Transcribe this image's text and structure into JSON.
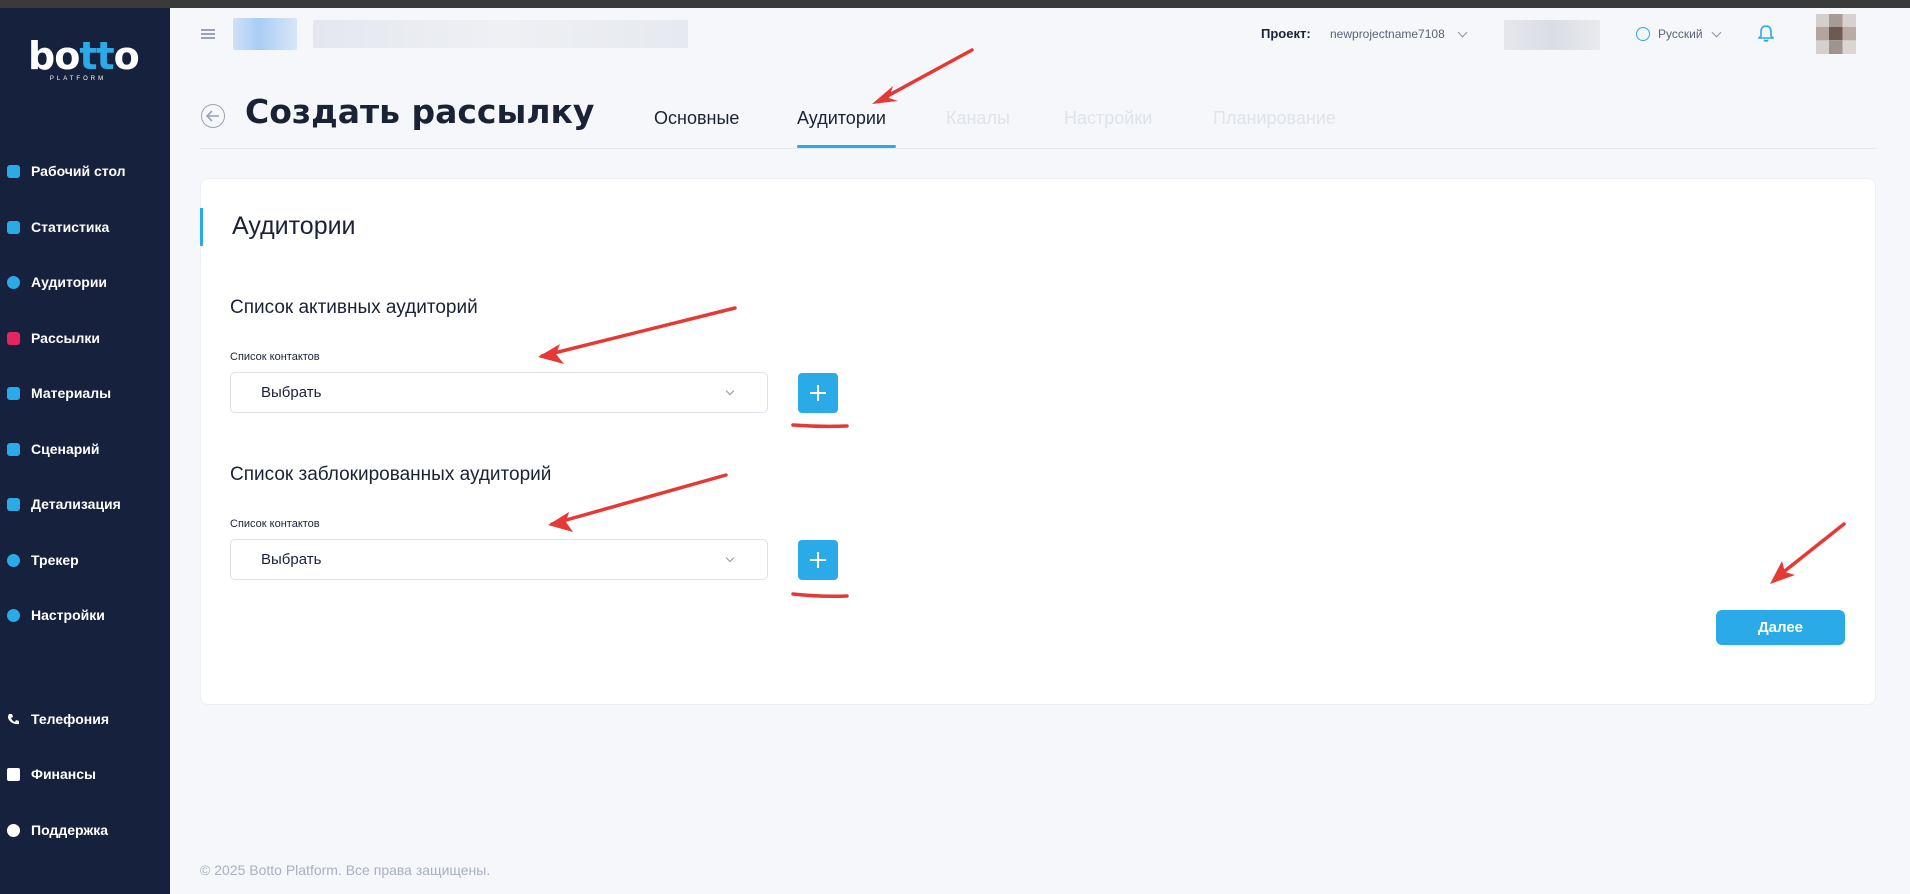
{
  "app": {
    "logo_text": "botto",
    "logo_subtitle": "PLATFORM"
  },
  "sidebar": {
    "items": [
      {
        "label": "Рабочий стол",
        "icon": "dashboard-icon"
      },
      {
        "label": "Статистика",
        "icon": "chart-icon"
      },
      {
        "label": "Аудитории",
        "icon": "users-icon"
      },
      {
        "label": "Рассылки",
        "icon": "mailing-icon"
      },
      {
        "label": "Материалы",
        "icon": "files-icon"
      },
      {
        "label": "Сценарий",
        "icon": "scenario-icon"
      },
      {
        "label": "Детализация",
        "icon": "details-icon"
      },
      {
        "label": "Трекер",
        "icon": "tracker-icon"
      },
      {
        "label": "Настройки",
        "icon": "gear-icon"
      },
      {
        "label": "Телефония",
        "icon": "phone-icon"
      },
      {
        "label": "Финансы",
        "icon": "wallet-icon"
      },
      {
        "label": "Поддержка",
        "icon": "support-icon"
      }
    ]
  },
  "header": {
    "project_label": "Проект:",
    "project_value": "newprojectname7108",
    "language": "Русский"
  },
  "page": {
    "title": "Создать рассылку",
    "tabs": [
      {
        "label": "Основные",
        "state": "enabled"
      },
      {
        "label": "Аудитории",
        "state": "active"
      },
      {
        "label": "Каналы",
        "state": "disabled"
      },
      {
        "label": "Настройки",
        "state": "disabled"
      },
      {
        "label": "Планирование",
        "state": "disabled"
      }
    ]
  },
  "card": {
    "title": "Аудитории",
    "active_section": {
      "title": "Список активных аудиторий",
      "field_label": "Список контактов",
      "select_value": "Выбрать"
    },
    "blocked_section": {
      "title": "Список заблокированных аудиторий",
      "field_label": "Список контактов",
      "select_value": "Выбрать"
    },
    "next_button": "Далее"
  },
  "footer": {
    "copyright": "© 2025 Botto Platform. Все права защищены."
  },
  "colors": {
    "sidebar_bg": "#16213e",
    "accent": "#2aaae7",
    "annotation_red": "#e53935",
    "mailing_icon": "#e6245e"
  }
}
